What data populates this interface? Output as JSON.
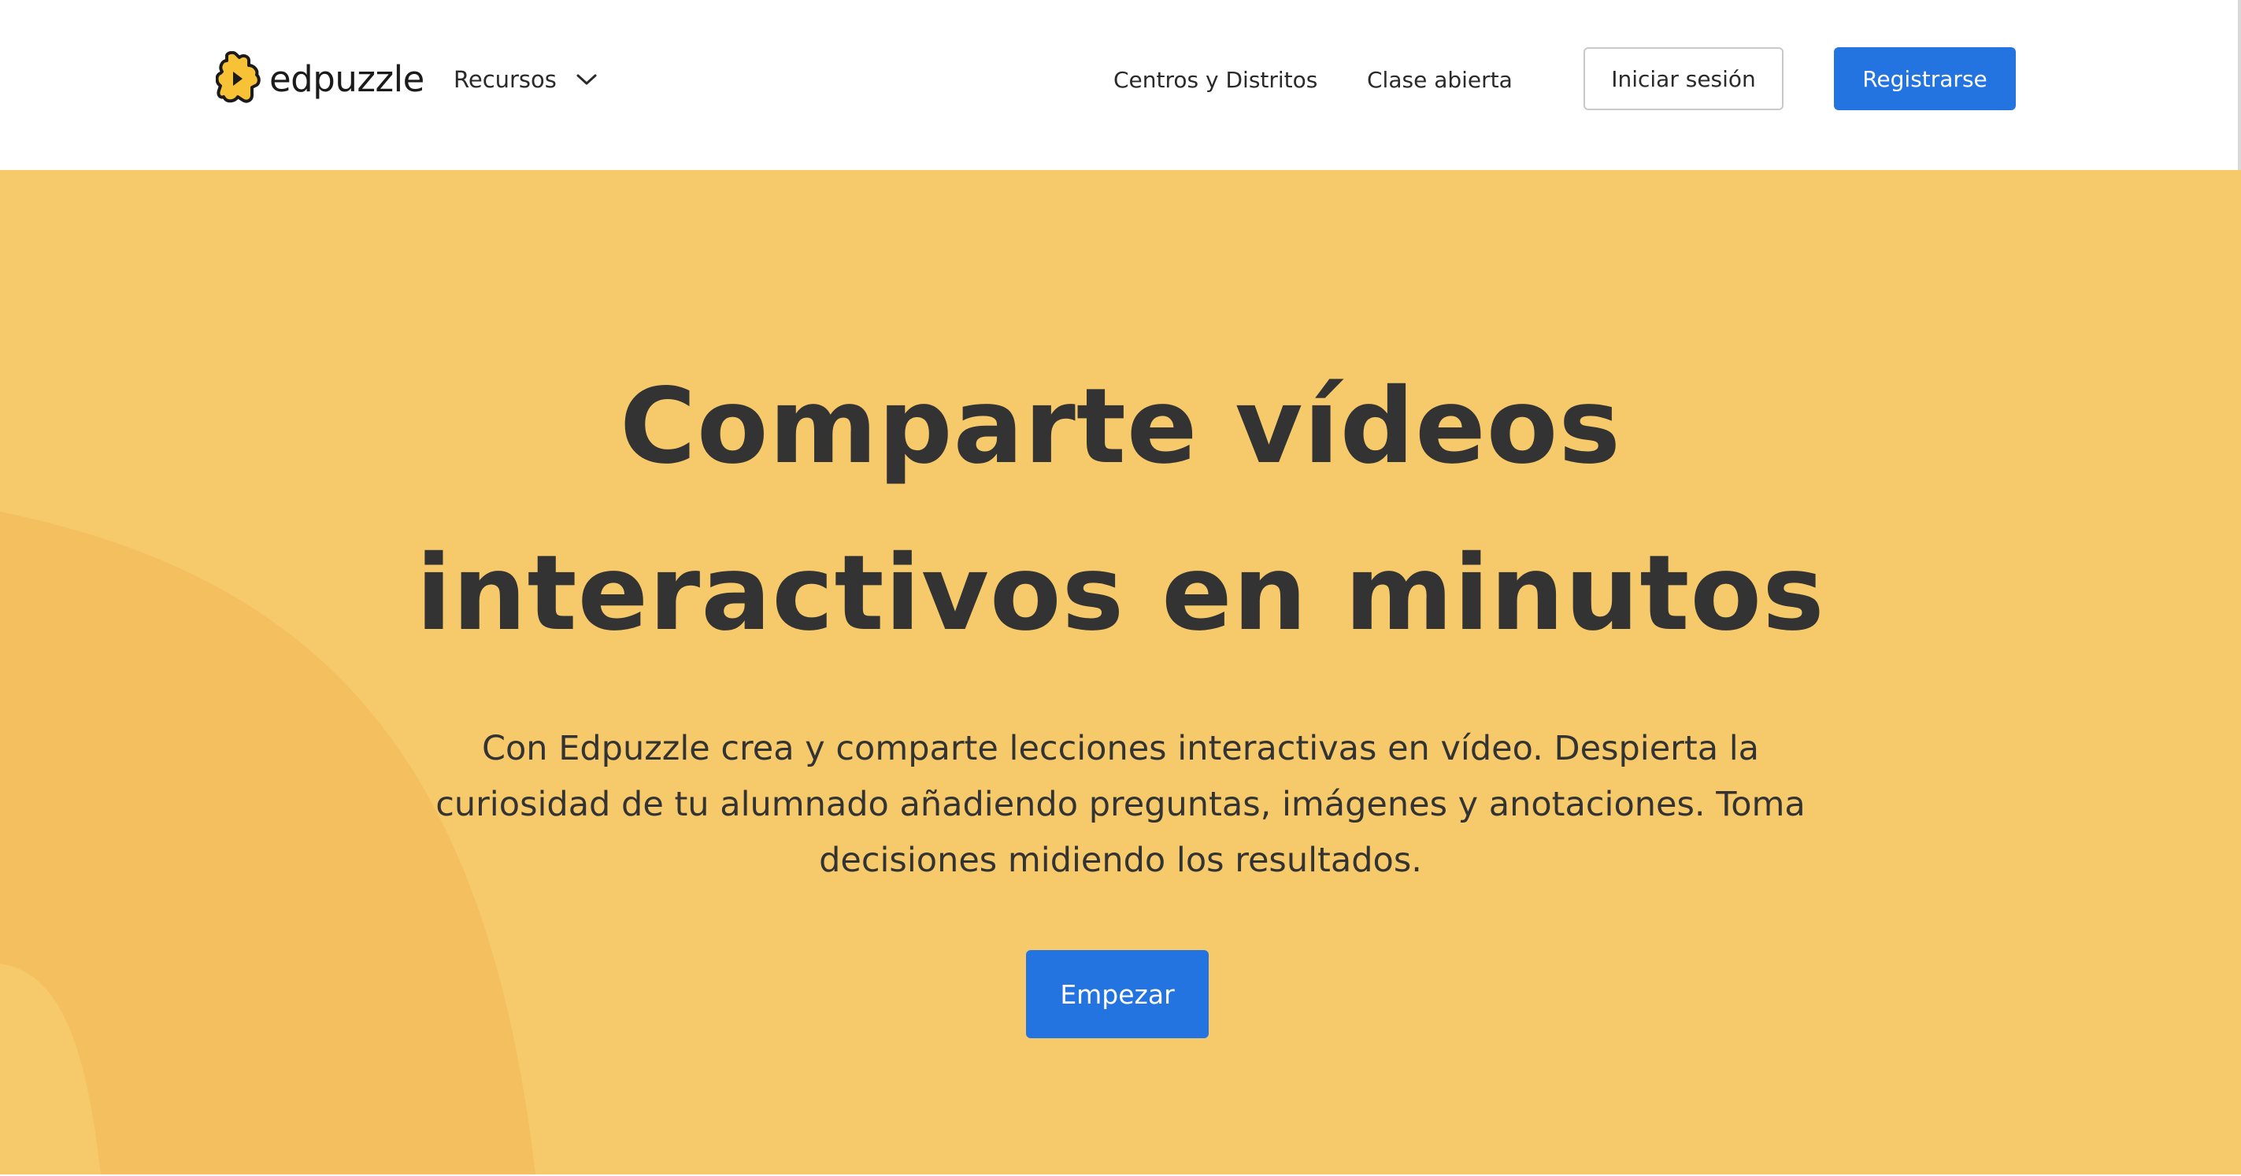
{
  "header": {
    "logo_text": "edpuzzle",
    "resources_label": "Recursos",
    "nav_links": [
      {
        "label": "Centros y Distritos"
      },
      {
        "label": "Clase abierta"
      }
    ],
    "login_label": "Iniciar sesión",
    "register_label": "Registrarse"
  },
  "hero": {
    "title_line_1": "Comparte vídeos",
    "title_line_2": "interactivos en minutos",
    "description": "Con Edpuzzle crea y comparte lecciones interactivas en vídeo. Despierta la curiosidad de tu alumnado añadiendo preguntas, imágenes y anotaciones. Toma decisiones midiendo los resultados.",
    "cta_label": "Empezar"
  },
  "colors": {
    "hero_background": "#f6ca6a",
    "hero_shape": "#f4bf5e",
    "primary_button": "#2374e1",
    "text": "#333333",
    "logo_fill": "#f8c237"
  },
  "icons": {
    "logo": "edpuzzle-puzzle-logo-icon",
    "resources_dropdown": "chevron-down-icon"
  }
}
